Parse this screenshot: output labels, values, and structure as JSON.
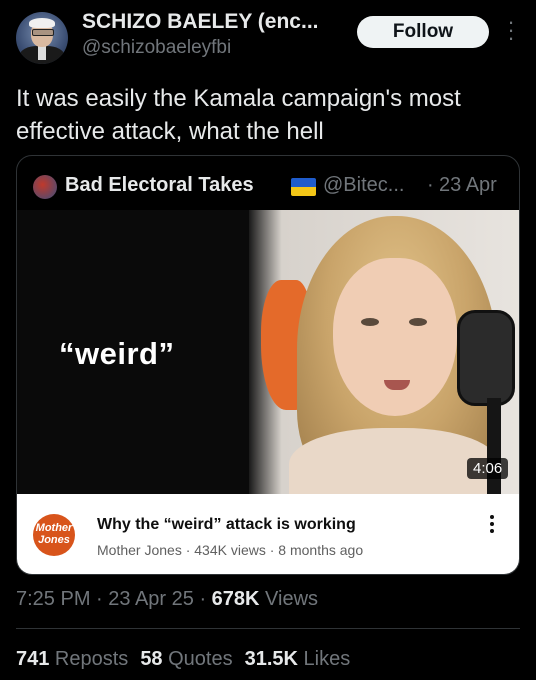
{
  "author": {
    "display_name": "SCHIZO BAELEY (enc...",
    "handle": "@schizobaeleyfbi"
  },
  "follow_label": "Follow",
  "tweet_text": "It was easily the Kamala campaign's most effective attack, what the hell",
  "quoted": {
    "name": "Bad Electoral Takes",
    "handle": "@Bitec...",
    "separator": "·",
    "date": "23 Apr",
    "media": {
      "overlay_text": "“weird”",
      "duration": "4:06"
    },
    "video": {
      "channel_logo_text": "Mother Jones",
      "title": "Why the “weird” attack is working",
      "meta": "Mother Jones · 434K views · 8 months ago"
    }
  },
  "footer": {
    "time": "7:25 PM · 23 Apr 25 · ",
    "views_count": "678K",
    "views_label": " Views"
  },
  "stats": {
    "reposts_count": "741",
    "reposts_label": " Reposts",
    "quotes_count": "58",
    "quotes_label": " Quotes",
    "likes_count": "31.5K",
    "likes_label": " Likes"
  }
}
